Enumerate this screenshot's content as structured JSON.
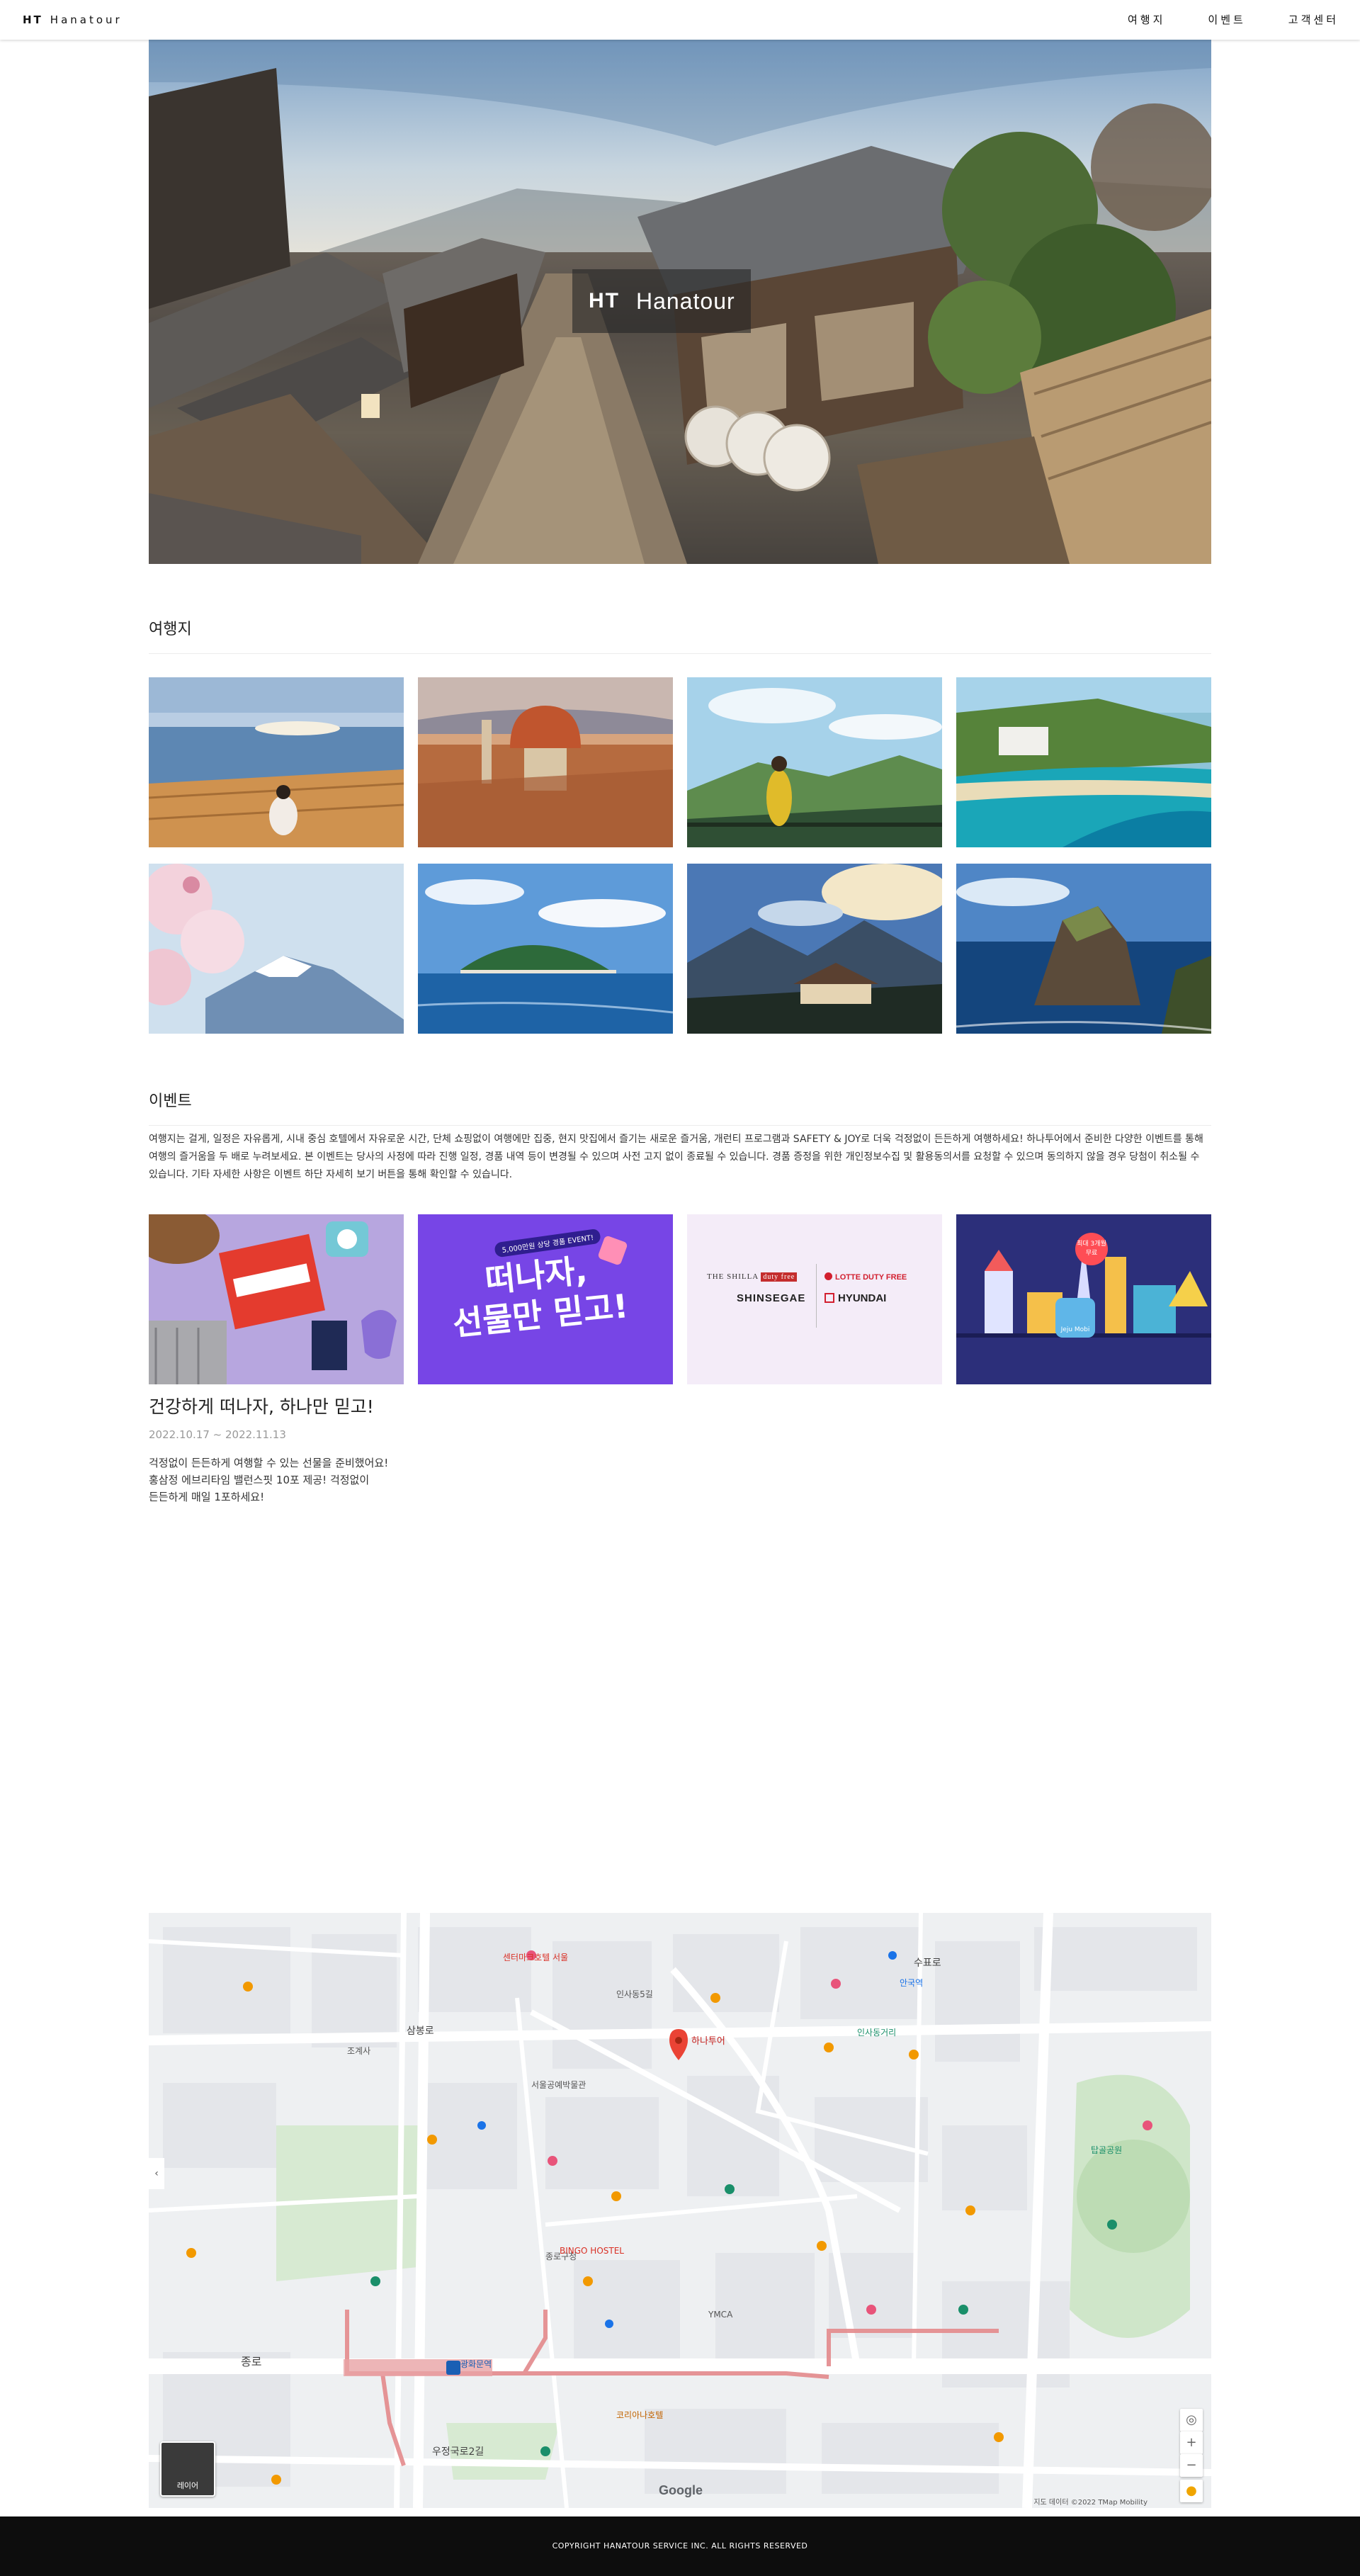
{
  "nav": {
    "brand_mark": "HT",
    "brand_name": "Hanatour",
    "menu": [
      "여행지",
      "이벤트",
      "고객센터"
    ]
  },
  "hero": {
    "logo_mark": "HT",
    "logo_name": "Hanatour"
  },
  "destinations": {
    "title": "여행지",
    "items": [
      {
        "icon": "seaside-deck-photo"
      },
      {
        "icon": "cathedral-city-photo"
      },
      {
        "icon": "green-hills-photo"
      },
      {
        "icon": "resort-coast-photo"
      },
      {
        "icon": "snowy-mountain-photo"
      },
      {
        "icon": "island-sea-photo"
      },
      {
        "icon": "mountain-house-photo"
      },
      {
        "icon": "rocky-island-photo"
      }
    ]
  },
  "events": {
    "title": "이벤트",
    "description": "여행지는 걸게, 일정은 자유롭게, 시내 중심 호텔에서 자유로운 시간, 단체 쇼핑없이 여행에만 집중, 현지 맛집에서 즐기는 새로운 즐거움, 개런티 프로그램과 SAFETY & JOY로 더욱 걱정없이 든든하게 여행하세요! 하나투어에서 준비한 다양한 이벤트를 통해 여행의 즐거움을 두 배로 누려보세요. 본 이벤트는 당사의 사정에 따라 진행 일정, 경품 내역 등이 변경될 수 있으며 사전 고지 없이 종료될 수 있습니다. 경품 증정을 위한 개인정보수집 및 활용동의서를 요청할 수 있으며 동의하지 않을 경우 당첨이 취소될 수 있습니다. 기타 자세한 사항은 이벤트 하단 자세히 보기 버튼을 통해 확인할 수 있습니다.",
    "card2": {
      "badge": "5,000만원 상당 경품 EVENT!",
      "line1": "떠나자,",
      "line2": "선물만 믿고!"
    },
    "card3": {
      "shilla": "THE SHILLA",
      "shilla_tag": "duty free",
      "lotte": "LOTTE DUTY FREE",
      "shinsegae": "SHINSEGAE",
      "hyundai": "HYUNDAI"
    },
    "card4": {
      "badge_line1": "최대 3개월",
      "badge_line2": "무료",
      "device": "Jeju Mobi"
    },
    "featured": {
      "title": "건강하게 떠나자, 하나만 믿고!",
      "date": "2022.10.17 ~ 2022.11.13",
      "desc_lines": [
        "걱정없이 든든하게 여행할 수 있는 선물을 준비했어요!",
        "홍삼정 에브리타임 밸런스핏 10포 제공! 걱정없이",
        "든든하게 매일 1포하세요!"
      ]
    }
  },
  "map": {
    "pin_label": "하나투어",
    "layer_label": "레이어",
    "google": "Google",
    "attribution": "지도 데이터 ©2022 TMap Mobility",
    "labels": [
      "삼봉로",
      "종로",
      "우정국로2길",
      "인사동5길",
      "수표로",
      "서울공예박물관",
      "탑골공원",
      "하나투어",
      "인사동거리",
      "센터마크호텔 서울",
      "안국역",
      "조계사",
      "종로구청",
      "코리아나호텔",
      "광화문역",
      "BINGO HOSTEL",
      "YMCA"
    ]
  },
  "footer": {
    "copyright": "COPYRIGHT HANATOUR SERVICE INC. ALL RIGHTS RESERVED"
  }
}
